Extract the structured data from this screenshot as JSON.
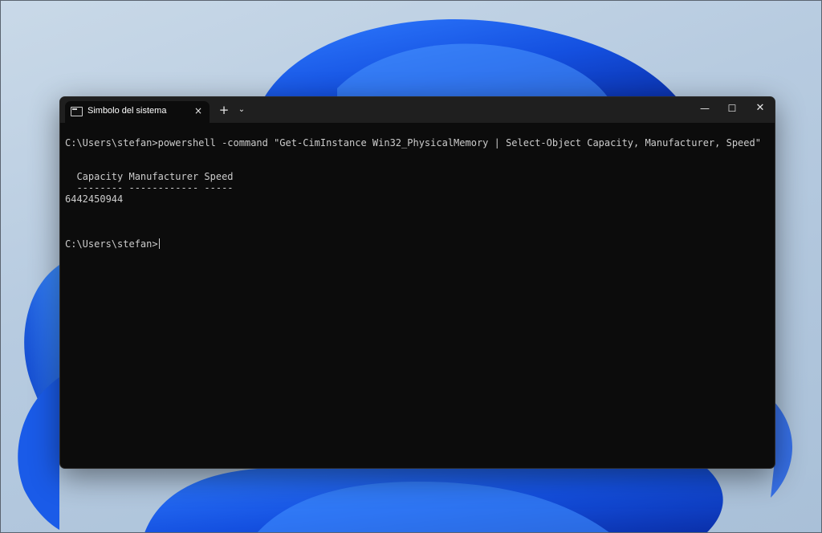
{
  "window": {
    "tab_title": "Simbolo del sistema",
    "tab_close_icon": "×",
    "new_tab_icon": "+",
    "dropdown_icon": "⌄",
    "minimize_icon": "—",
    "maximize_icon": "☐",
    "close_icon": "✕"
  },
  "terminal": {
    "lines": [
      "C:\\Users\\stefan>powershell -command \"Get-CimInstance Win32_PhysicalMemory | Select-Object Capacity, Manufacturer, Speed\"",
      "",
      "",
      "  Capacity Manufacturer Speed",
      "  -------- ------------ -----",
      "6442450944",
      "",
      "",
      "",
      "C:\\Users\\stefan>"
    ]
  },
  "colors": {
    "terminal_background": "#0c0c0c",
    "terminal_text": "#cccccc",
    "titlebar": "#1f1f1f",
    "wallpaper_accent": "#1a5be8"
  }
}
